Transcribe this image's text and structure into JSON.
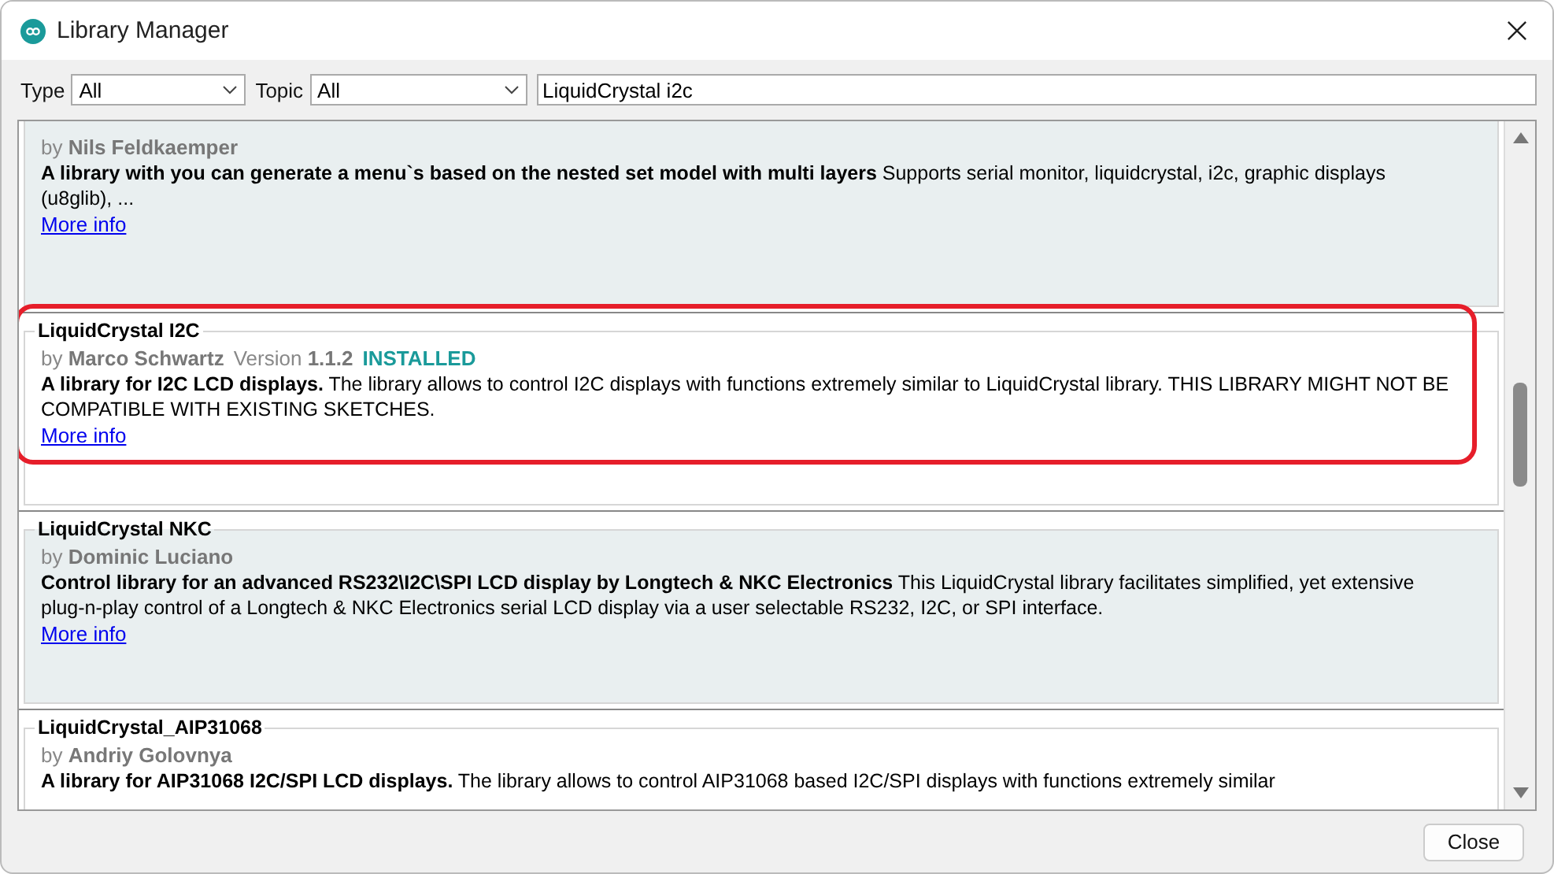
{
  "window": {
    "title": "Library Manager"
  },
  "filters": {
    "type_label": "Type",
    "type_value": "All",
    "topic_label": "Topic",
    "topic_value": "All",
    "search_value": "LiquidCrystal i2c"
  },
  "libraries": [
    {
      "byline": "by **Nils Feldkaemper**",
      "description": "**A library with you can generate a menu`s based on the nested set model with multi layers** Supports serial monitor, liquidcrystal, i2c, graphic displays (u8glib), ...",
      "link": "More info",
      "highlighted": false
    },
    {
      "title": "LiquidCrystal I2C",
      "byline": "by **Marco Schwartz**",
      "version": "Version **1.1.2**",
      "status": "INSTALLED",
      "description": "**A library for I2C LCD displays.** The library allows to control I2C displays with functions extremely similar to LiquidCrystal library. THIS LIBRARY MIGHT NOT BE COMPATIBLE WITH EXISTING SKETCHES.",
      "link": "More info",
      "highlighted": true
    },
    {
      "title": "LiquidCrystal NKC",
      "byline": "by **Dominic Luciano**",
      "description": "**Control library for an advanced RS232\\I2C\\SPI LCD display by Longtech & NKC Electronics** This LiquidCrystal library facilitates simplified, yet extensive plug-n-play control of a Longtech & NKC Electronics serial LCD display via a user selectable RS232, I2C, or SPI interface.",
      "link": "More info",
      "highlighted": false
    },
    {
      "title": "LiquidCrystal_AIP31068",
      "byline": "by **Andriy Golovnya**",
      "description": "**A library for AIP31068 I2C/SPI LCD displays.** The library allows to control AIP31068 based I2C/SPI displays with functions extremely similar",
      "highlighted": false
    }
  ],
  "close_button": "Close"
}
